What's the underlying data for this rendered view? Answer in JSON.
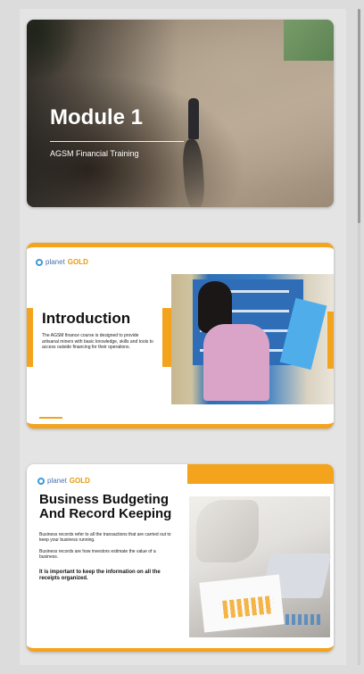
{
  "slides": [
    {
      "title": "Module 1",
      "subtitle": "AGSM Financial Training"
    },
    {
      "logo": {
        "prefix": "planet",
        "suffix": "GOLD"
      },
      "heading": "Introduction",
      "body": "The AGSM finance course is designed to provide artisanal miners with basic knowledge, skills and tools to access outside financing for their operations."
    },
    {
      "logo": {
        "prefix": "planet",
        "suffix": "GOLD"
      },
      "heading": "Business Budgeting And Record Keeping",
      "paragraph1": "Business records refer to all the transactions that are carried out to keep your business running.",
      "paragraph2": "Business records are how investors estimate the value of a business.",
      "emphasis": "It is important to keep the information on all the receipts organized."
    }
  ],
  "colors": {
    "accent": "#f4a31c",
    "background": "#dcdcdc",
    "logo_blue": "#3a9bd8"
  },
  "icons": {
    "logo": "planet-ring-icon"
  }
}
